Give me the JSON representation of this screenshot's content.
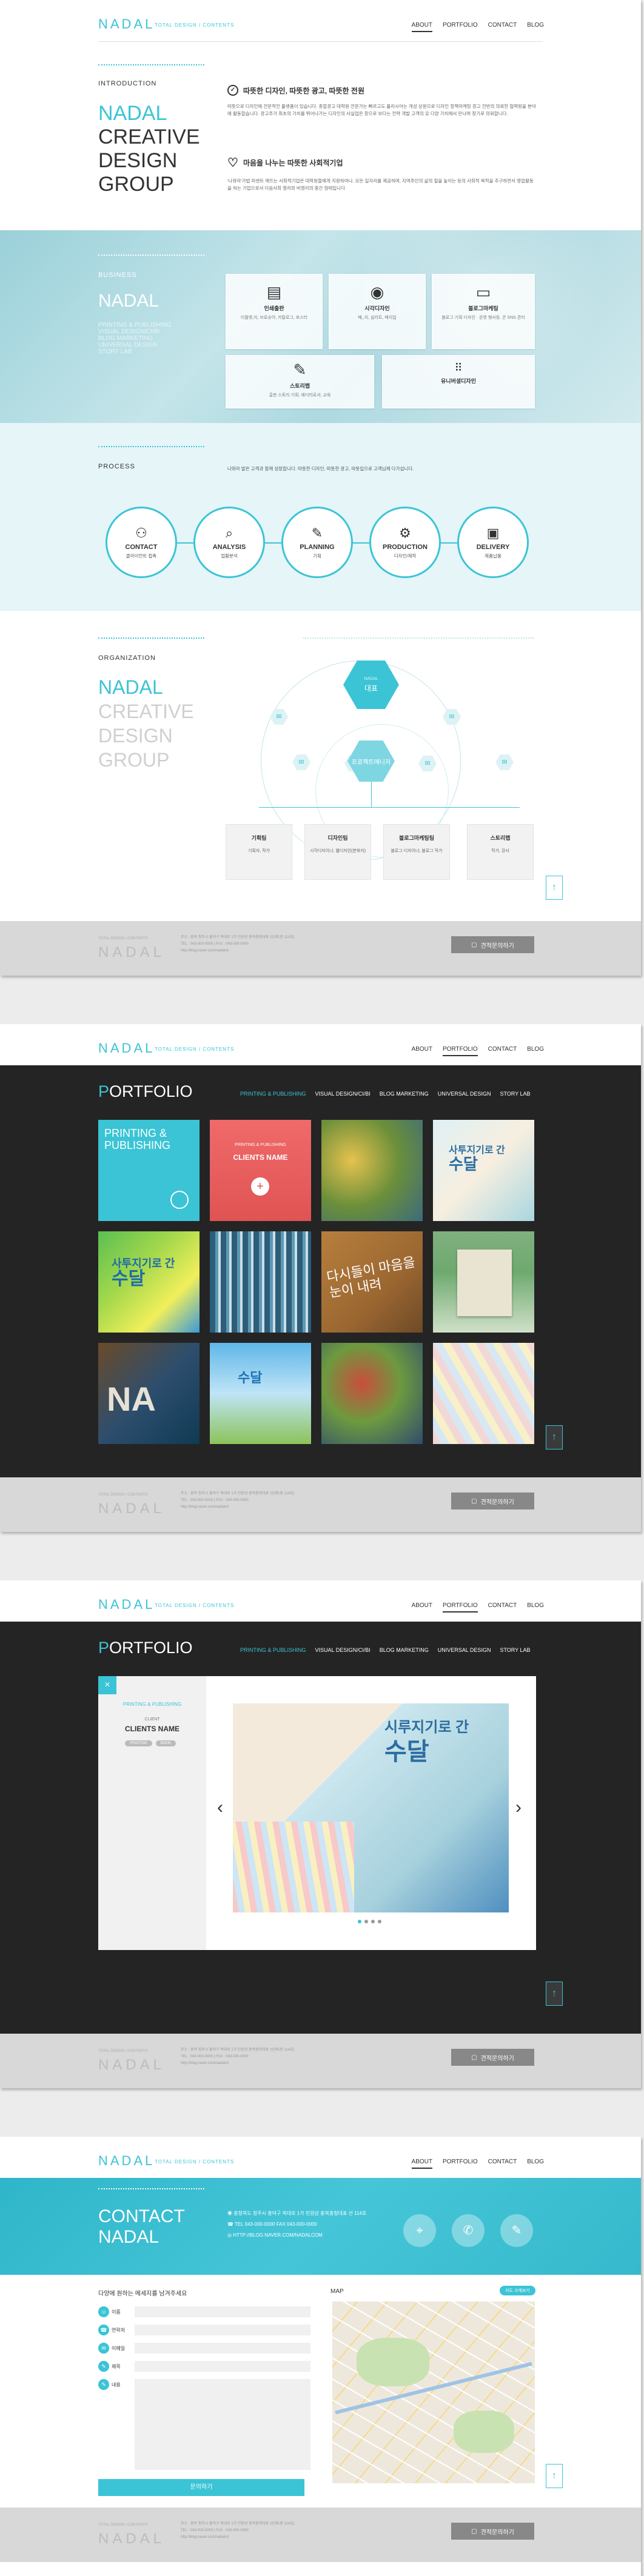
{
  "header": {
    "logo": "NADAL",
    "tagline": "TOTAL DESIGN / CONTENTS",
    "nav": [
      "ABOUT",
      "PORTFOLIO",
      "CONTACT",
      "BLOG"
    ]
  },
  "about": {
    "intro_label": "INTRODUCTION",
    "title_line1": "NADAL",
    "title_line2": "CREATIVE",
    "title_line3": "DESIGN",
    "title_line4": "GROUP",
    "block1_heading": "따뜻한 디자인, 따뜻한 광고, 따뜻한 전원",
    "block1_text": "따뜻으로 디자인에 전문적인 플랫폼이 있습니다. 종합광고 대학원 전문가는 빠르고도 플리시어는 개성 상원으로 디자인 정책마케팅 광고 전반의 의뢰한 협력방을 분야에 활동합습니다. 광고주가 최초의 가치를 뛰어나가는 디자인의 사실업은 창으로 보다는 전략 개발 고객의 유 다양 가치에서 만나며 창기로 의뢰합니다.",
    "block2_heading": "마음을 나누는 따뜻한 사회적기업",
    "block2_text": "'나와라'가법 퍼센트 깨뜨는 사회적기업은 대학원들에게 지원하여나, 모든 일자리를 제공하며, 지역주민의 삶의 질을 높이는 등의 사회적 목적을 추구하면서 영업활동을 하는 기업으로서 다음사회 영리와 비영리의 중간 형태입니다."
  },
  "business": {
    "label": "BUSINESS",
    "title": "NADAL",
    "list": [
      "PRINTING & PUBLISHING",
      "VISUAL DESIGN/CI/BI",
      "BLOG MARKETING",
      "UNIVERSAL DESIGN",
      "STORY LAB"
    ],
    "cards": [
      {
        "title": "인쇄출판",
        "desc": "리플렛,지, 브로슈어, 카탈로그, 포스터"
      },
      {
        "title": "시각디자인",
        "desc": "패,,지, 실리트, 매지업"
      },
      {
        "title": "블로그마케팅",
        "desc": "블로그 기획 디자인 · 운영 행사등, 콘 SNS 관리"
      },
      {
        "title": "스토리랩",
        "desc": "출판 스토리 기획, 에디터로서, 교육"
      },
      {
        "title": "유니버셜디자인",
        "desc": ""
      }
    ]
  },
  "process": {
    "label": "PROCESS",
    "desc": "나와라 발은 고객과 함께 성장합니다. 따뜻한 디자인, 따뜻한 광고, 따뜻입으로 고객님께 다가섭니다.",
    "steps": [
      {
        "title": "CONTACT",
        "desc": "클라이언트 접촉"
      },
      {
        "title": "ANALYSIS",
        "desc": "업황분석"
      },
      {
        "title": "PLANNING",
        "desc": "기획"
      },
      {
        "title": "PRODUCTION",
        "desc": "디자인/제작"
      },
      {
        "title": "DELIVERY",
        "desc": "제품납품"
      }
    ]
  },
  "organization": {
    "label": "ORGANIZATION",
    "title_line1": "NADAL",
    "title_line2": "CREATIVE",
    "title_line3": "DESIGN",
    "title_line4": "GROUP",
    "top_small": "NADAL",
    "top_big": "대표",
    "mid": "프로젝트매니저",
    "departments": [
      {
        "title": "기획팀",
        "desc": "기획자, 작가"
      },
      {
        "title": "디자인팀",
        "desc": "시각디자이너, 웹디자인(분화자)"
      },
      {
        "title": "블로그마케팅팀",
        "desc": "블로그 디자이너, 블로그 작가"
      },
      {
        "title": "스토리랩",
        "desc": "작가, 강사"
      }
    ]
  },
  "footer": {
    "small": "TOTAL DESIGN / CONTENTS",
    "logo": "NADAL",
    "info1": "주소 : 충북 청주시 흥덕구 복대로 1가 민원상 충북충청대표 선(제1층 114호)",
    "info2": "TEL : 043-000-0000 | FAX : 043-000-0000",
    "info3": "http://blog.naver.com/nadalnd",
    "button": "견적문의하기"
  },
  "portfolio": {
    "title_first": "P",
    "title_rest": "ORTFOLIO",
    "categories": [
      "PRINTING & PUBLISHING",
      "VISUAL DESIGN/CI/BI",
      "BLOG MARKETING",
      "UNIVERSAL DESIGN",
      "STORY LAB"
    ],
    "feature_line1": "PRINTING &",
    "feature_line2": "PUBLISHING",
    "hover_category": "PRINTING & PUBLISHING",
    "hover_client": "CLIENTS NAME",
    "hover_plus": "+",
    "book_text": "시루지기로 간 수달",
    "tile_text_a": "사투지기로 간",
    "tile_text_b": "수달",
    "tile_text_c": "다시들이 마음을 눈이 내려"
  },
  "detail": {
    "category": "PRINTING & PUBLISHING",
    "client_label": "CLIENT",
    "client_name": "CLIENTS NAME",
    "tag1": "PRINTING",
    "tag2": "BOOK",
    "book_line1": "시루지기로 간",
    "book_line2": "수달",
    "prev": "‹",
    "next": "›"
  },
  "contact": {
    "title_line1": "CONTACT",
    "title_line2": "NADAL",
    "address": "충청북도 청주시 흥덕구 복대로 1가 민원상 충북충청대표 선 114호",
    "tel": "TEL 043-000-0000   FAX 043-000-0000",
    "url": "HTTP://BLOG.NAVER.COM/NADALCOM",
    "form_heading": "다양에 원하는 메세지를 남겨주세요",
    "fields": [
      "이름",
      "연락처",
      "이메일",
      "제목",
      "내용"
    ],
    "submit": "문의하기",
    "map_label": "MAP",
    "map_button": "지도 크게보기"
  },
  "icons": {
    "up": "up-arrow-icon"
  },
  "colors": {
    "accent": "#3bc4d6",
    "dark": "#242424"
  }
}
